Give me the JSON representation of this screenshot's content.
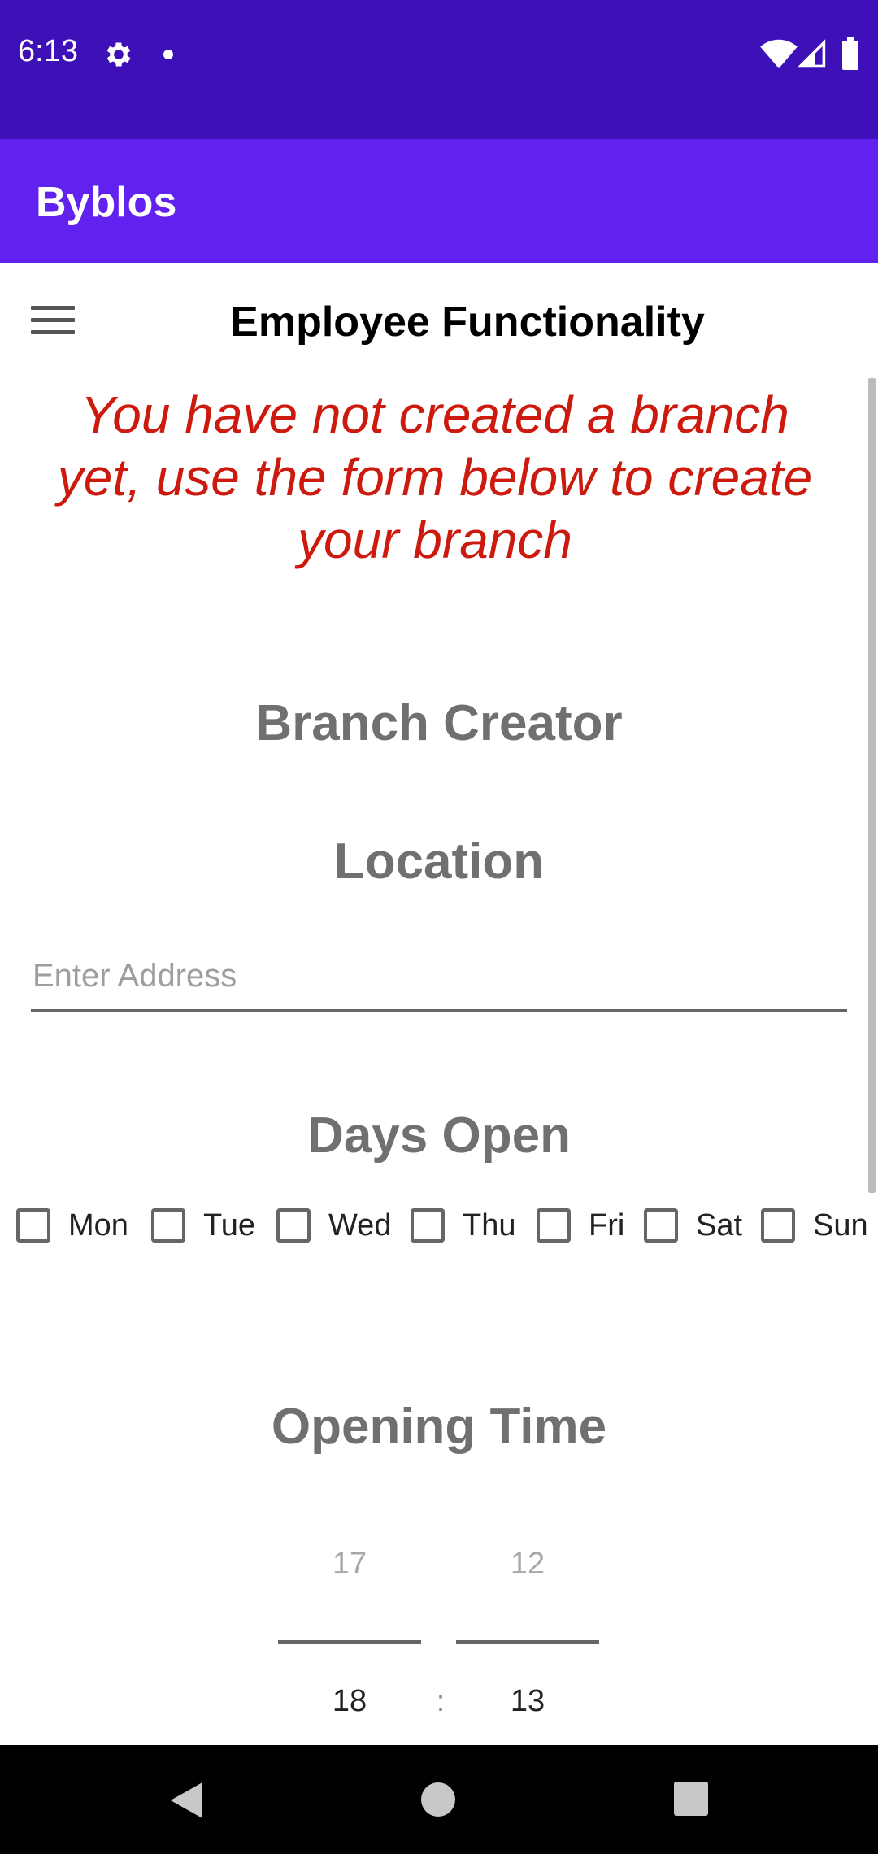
{
  "status_bar": {
    "time": "6:13"
  },
  "app_bar": {
    "title": "Byblos"
  },
  "screen": {
    "title": "Employee Functionality",
    "warning": "You have not created a branch yet, use the form below to create your branch"
  },
  "form": {
    "heading": "Branch Creator",
    "location_heading": "Location",
    "address_placeholder": "Enter Address",
    "days_heading": "Days Open",
    "days": [
      {
        "label": "Mon",
        "checked": false
      },
      {
        "label": "Tue",
        "checked": false
      },
      {
        "label": "Wed",
        "checked": false
      },
      {
        "label": "Thu",
        "checked": false
      },
      {
        "label": "Fri",
        "checked": false
      },
      {
        "label": "Sat",
        "checked": false
      },
      {
        "label": "Sun",
        "checked": false
      }
    ],
    "opening_time_heading": "Opening Time",
    "time_picker": {
      "hour_prev": "17",
      "hour": "18",
      "minute_prev": "12",
      "minute": "13",
      "separator": ":"
    }
  },
  "colors": {
    "status_bar": "#3d10b8",
    "app_bar": "#6121ee",
    "warning_text": "#cc1a0e",
    "heading_text": "#707070"
  }
}
